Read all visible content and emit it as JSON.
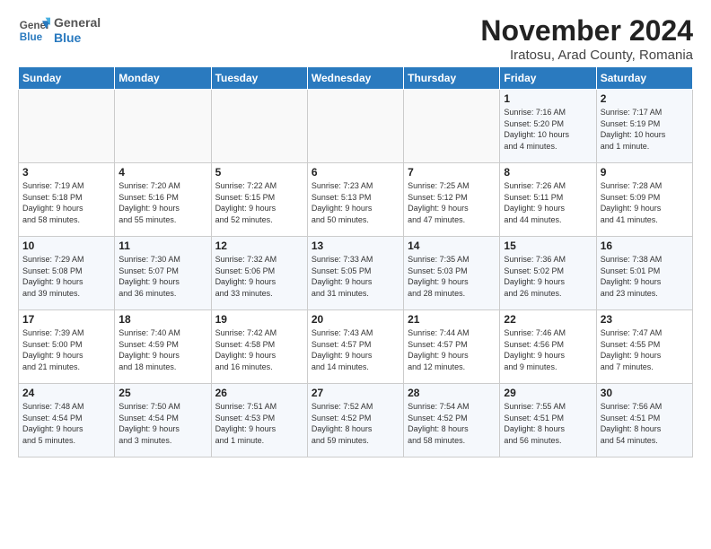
{
  "logo": {
    "line1": "General",
    "line2": "Blue"
  },
  "title": "November 2024",
  "subtitle": "Iratosu, Arad County, Romania",
  "weekdays": [
    "Sunday",
    "Monday",
    "Tuesday",
    "Wednesday",
    "Thursday",
    "Friday",
    "Saturday"
  ],
  "weeks": [
    [
      {
        "day": "",
        "info": ""
      },
      {
        "day": "",
        "info": ""
      },
      {
        "day": "",
        "info": ""
      },
      {
        "day": "",
        "info": ""
      },
      {
        "day": "",
        "info": ""
      },
      {
        "day": "1",
        "info": "Sunrise: 7:16 AM\nSunset: 5:20 PM\nDaylight: 10 hours\nand 4 minutes."
      },
      {
        "day": "2",
        "info": "Sunrise: 7:17 AM\nSunset: 5:19 PM\nDaylight: 10 hours\nand 1 minute."
      }
    ],
    [
      {
        "day": "3",
        "info": "Sunrise: 7:19 AM\nSunset: 5:18 PM\nDaylight: 9 hours\nand 58 minutes."
      },
      {
        "day": "4",
        "info": "Sunrise: 7:20 AM\nSunset: 5:16 PM\nDaylight: 9 hours\nand 55 minutes."
      },
      {
        "day": "5",
        "info": "Sunrise: 7:22 AM\nSunset: 5:15 PM\nDaylight: 9 hours\nand 52 minutes."
      },
      {
        "day": "6",
        "info": "Sunrise: 7:23 AM\nSunset: 5:13 PM\nDaylight: 9 hours\nand 50 minutes."
      },
      {
        "day": "7",
        "info": "Sunrise: 7:25 AM\nSunset: 5:12 PM\nDaylight: 9 hours\nand 47 minutes."
      },
      {
        "day": "8",
        "info": "Sunrise: 7:26 AM\nSunset: 5:11 PM\nDaylight: 9 hours\nand 44 minutes."
      },
      {
        "day": "9",
        "info": "Sunrise: 7:28 AM\nSunset: 5:09 PM\nDaylight: 9 hours\nand 41 minutes."
      }
    ],
    [
      {
        "day": "10",
        "info": "Sunrise: 7:29 AM\nSunset: 5:08 PM\nDaylight: 9 hours\nand 39 minutes."
      },
      {
        "day": "11",
        "info": "Sunrise: 7:30 AM\nSunset: 5:07 PM\nDaylight: 9 hours\nand 36 minutes."
      },
      {
        "day": "12",
        "info": "Sunrise: 7:32 AM\nSunset: 5:06 PM\nDaylight: 9 hours\nand 33 minutes."
      },
      {
        "day": "13",
        "info": "Sunrise: 7:33 AM\nSunset: 5:05 PM\nDaylight: 9 hours\nand 31 minutes."
      },
      {
        "day": "14",
        "info": "Sunrise: 7:35 AM\nSunset: 5:03 PM\nDaylight: 9 hours\nand 28 minutes."
      },
      {
        "day": "15",
        "info": "Sunrise: 7:36 AM\nSunset: 5:02 PM\nDaylight: 9 hours\nand 26 minutes."
      },
      {
        "day": "16",
        "info": "Sunrise: 7:38 AM\nSunset: 5:01 PM\nDaylight: 9 hours\nand 23 minutes."
      }
    ],
    [
      {
        "day": "17",
        "info": "Sunrise: 7:39 AM\nSunset: 5:00 PM\nDaylight: 9 hours\nand 21 minutes."
      },
      {
        "day": "18",
        "info": "Sunrise: 7:40 AM\nSunset: 4:59 PM\nDaylight: 9 hours\nand 18 minutes."
      },
      {
        "day": "19",
        "info": "Sunrise: 7:42 AM\nSunset: 4:58 PM\nDaylight: 9 hours\nand 16 minutes."
      },
      {
        "day": "20",
        "info": "Sunrise: 7:43 AM\nSunset: 4:57 PM\nDaylight: 9 hours\nand 14 minutes."
      },
      {
        "day": "21",
        "info": "Sunrise: 7:44 AM\nSunset: 4:57 PM\nDaylight: 9 hours\nand 12 minutes."
      },
      {
        "day": "22",
        "info": "Sunrise: 7:46 AM\nSunset: 4:56 PM\nDaylight: 9 hours\nand 9 minutes."
      },
      {
        "day": "23",
        "info": "Sunrise: 7:47 AM\nSunset: 4:55 PM\nDaylight: 9 hours\nand 7 minutes."
      }
    ],
    [
      {
        "day": "24",
        "info": "Sunrise: 7:48 AM\nSunset: 4:54 PM\nDaylight: 9 hours\nand 5 minutes."
      },
      {
        "day": "25",
        "info": "Sunrise: 7:50 AM\nSunset: 4:54 PM\nDaylight: 9 hours\nand 3 minutes."
      },
      {
        "day": "26",
        "info": "Sunrise: 7:51 AM\nSunset: 4:53 PM\nDaylight: 9 hours\nand 1 minute."
      },
      {
        "day": "27",
        "info": "Sunrise: 7:52 AM\nSunset: 4:52 PM\nDaylight: 8 hours\nand 59 minutes."
      },
      {
        "day": "28",
        "info": "Sunrise: 7:54 AM\nSunset: 4:52 PM\nDaylight: 8 hours\nand 58 minutes."
      },
      {
        "day": "29",
        "info": "Sunrise: 7:55 AM\nSunset: 4:51 PM\nDaylight: 8 hours\nand 56 minutes."
      },
      {
        "day": "30",
        "info": "Sunrise: 7:56 AM\nSunset: 4:51 PM\nDaylight: 8 hours\nand 54 minutes."
      }
    ]
  ]
}
